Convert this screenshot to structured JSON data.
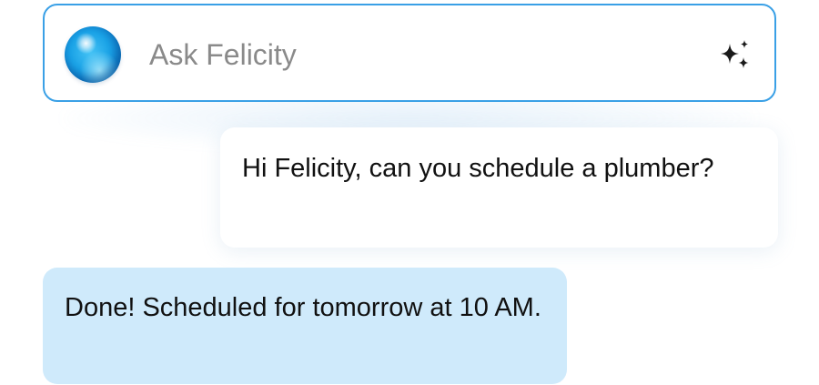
{
  "ask_bar": {
    "placeholder": "Ask Felicity",
    "avatar_icon": "felicity-orb-icon",
    "ai_icon": "sparkle-icon",
    "border_color": "#3aa0e6"
  },
  "messages": [
    {
      "role": "user",
      "text": "Hi Felicity, can you schedule a plumber?"
    },
    {
      "role": "assistant",
      "text": "Done! Scheduled for tomorrow at 10 AM."
    }
  ],
  "colors": {
    "assistant_bubble": "#cfeafb",
    "user_bubble": "#ffffff",
    "placeholder_text": "#8a8a8a"
  }
}
